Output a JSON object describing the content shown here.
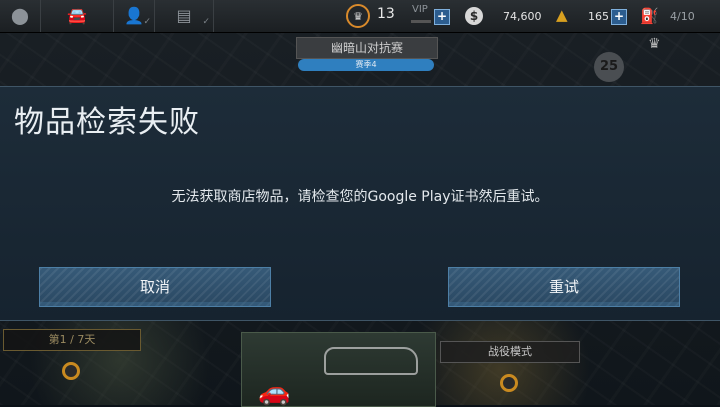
{
  "topbar": {
    "icons": [
      "map-pin-icon",
      "car-icon",
      "user-add-icon",
      "news-icon"
    ],
    "crown_count": "13",
    "vip_label": "VIP",
    "money": "74,600",
    "gold": "165",
    "fuel": "4/10",
    "plus_label": "+"
  },
  "event": {
    "title": "幽暗山对抗赛",
    "subtitle": "赛季4",
    "badge": "25"
  },
  "dialog": {
    "title": "物品检索失败",
    "message": "无法获取商店物品，请检查您的Google Play证书然后重试。",
    "cancel_label": "取消",
    "retry_label": "重试"
  },
  "bottom": {
    "day_label": "第1 / 7天",
    "campaign_label": "战役模式"
  },
  "colors": {
    "dialog_bg": "#1d2c39",
    "button_bg": "#365a78",
    "accent_orange": "#d98a2b",
    "plus_blue": "#2c5d8f"
  }
}
